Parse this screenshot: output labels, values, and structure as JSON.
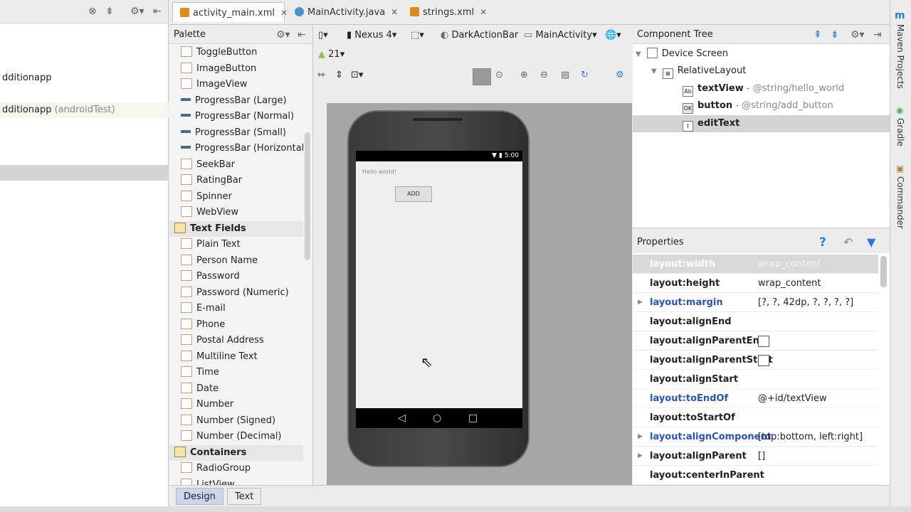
{
  "project_panel": {
    "items": [
      {
        "name": "dditionapp",
        "suffix": ""
      },
      {
        "name": "dditionapp",
        "suffix": "(androidTest)"
      }
    ]
  },
  "tabs": [
    {
      "label": "activity_main.xml",
      "active": true,
      "icon_color": "#e08a1e"
    },
    {
      "label": "MainActivity.java",
      "active": false,
      "icon_color": "#4a8fd1"
    },
    {
      "label": "strings.xml",
      "active": false,
      "icon_color": "#e08a1e"
    }
  ],
  "palette": {
    "title": "Palette",
    "widgets": [
      "ToggleButton",
      "ImageButton",
      "ImageView",
      "ProgressBar (Large)",
      "ProgressBar (Normal)",
      "ProgressBar (Small)",
      "ProgressBar (Horizontal)",
      "SeekBar",
      "RatingBar",
      "Spinner",
      "WebView"
    ],
    "text_fields_category": "Text Fields",
    "text_fields": [
      "Plain Text",
      "Person Name",
      "Password",
      "Password (Numeric)",
      "E-mail",
      "Phone",
      "Postal Address",
      "Multiline Text",
      "Time",
      "Date",
      "Number",
      "Number (Signed)",
      "Number (Decimal)"
    ],
    "containers_category": "Containers",
    "containers": [
      "RadioGroup",
      "ListView"
    ]
  },
  "design_toolbar": {
    "device": "Nexus 4",
    "theme": "DarkActionBar",
    "activity": "MainActivity",
    "api_level": "21"
  },
  "phone_preview": {
    "time": "5:00",
    "hello_text": "Hello world!",
    "button_label": "ADD"
  },
  "component_tree": {
    "title": "Component Tree",
    "device_screen": "Device Screen",
    "relative_layout": "RelativeLayout",
    "children": [
      {
        "name": "textView",
        "value": "- @string/hello_world",
        "icon": "Ab"
      },
      {
        "name": "button",
        "value": "- @string/add_button",
        "icon": "OK"
      },
      {
        "name": "editText",
        "value": "",
        "icon": "I"
      }
    ]
  },
  "properties": {
    "title": "Properties",
    "rows": [
      {
        "name": "layout:width",
        "value": "wrap_content"
      },
      {
        "name": "layout:height",
        "value": "wrap_content"
      },
      {
        "name": "layout:margin",
        "value": "[?, ?, 42dp, ?, ?, ?, ?]"
      },
      {
        "name": "layout:alignEnd",
        "value": ""
      },
      {
        "name": "layout:alignParentEnd",
        "value": ""
      },
      {
        "name": "layout:alignParentStart",
        "value": ""
      },
      {
        "name": "layout:alignStart",
        "value": ""
      },
      {
        "name": "layout:toEndOf",
        "value": "@+id/textView"
      },
      {
        "name": "layout:toStartOf",
        "value": ""
      },
      {
        "name": "layout:alignComponent",
        "value": "[top:bottom, left:right]"
      },
      {
        "name": "layout:alignParent",
        "value": "[]"
      },
      {
        "name": "layout:centerInParent",
        "value": ""
      }
    ]
  },
  "side_tools": [
    "Maven Projects",
    "Gradle",
    "Commander"
  ],
  "bottom_tabs": [
    "Design",
    "Text"
  ]
}
